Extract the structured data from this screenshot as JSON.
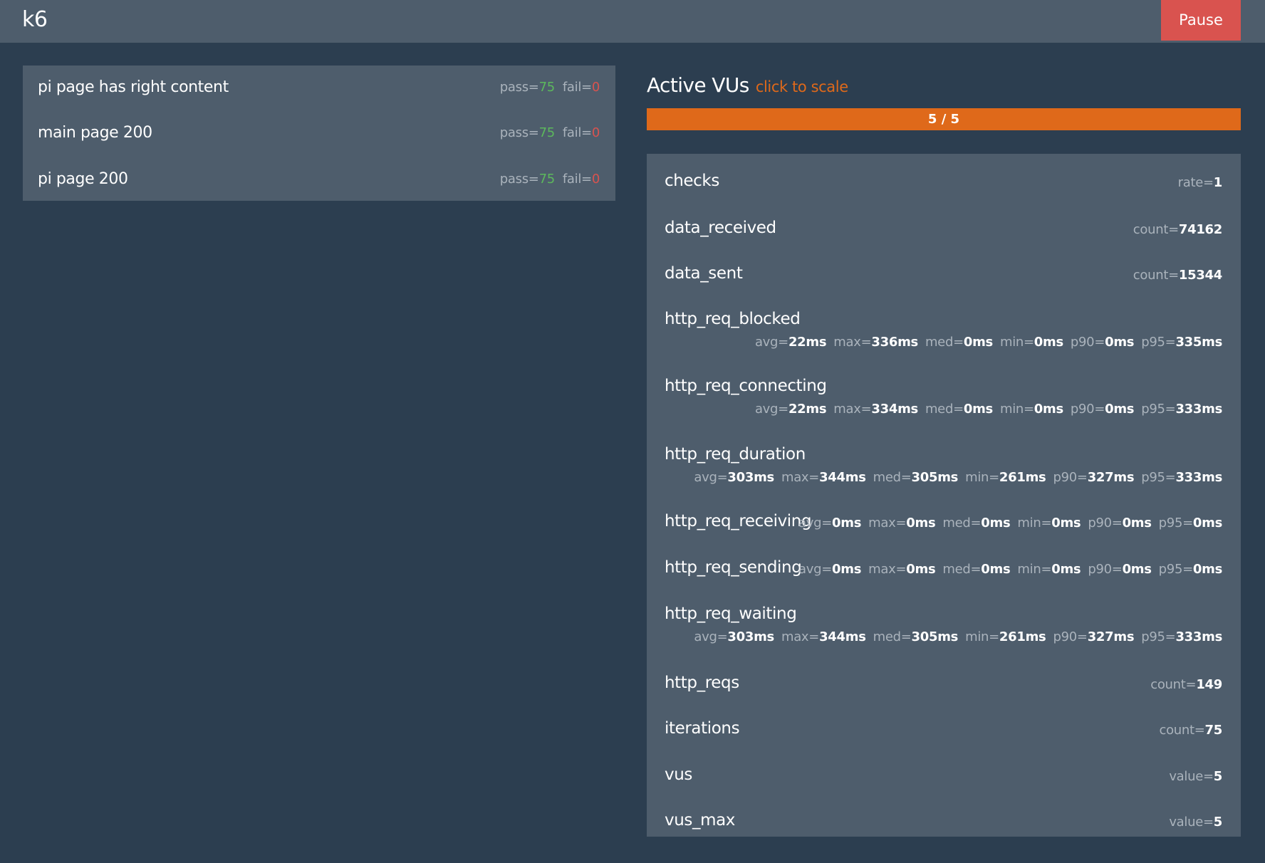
{
  "app": {
    "brand": "k6",
    "pause_label": "Pause"
  },
  "checks": [
    {
      "name": "pi page has right content",
      "pass_label": "pass=",
      "pass": "75",
      "fail_label": "fail=",
      "fail": "0"
    },
    {
      "name": "main page 200",
      "pass_label": "pass=",
      "pass": "75",
      "fail_label": "fail=",
      "fail": "0"
    },
    {
      "name": "pi page 200",
      "pass_label": "pass=",
      "pass": "75",
      "fail_label": "fail=",
      "fail": "0"
    }
  ],
  "vus": {
    "title": "Active VUs",
    "scale_link": "click to scale",
    "label": "5 / 5",
    "active": 5,
    "max": 5,
    "fill_fraction": 1.0
  },
  "metrics": [
    {
      "name": "checks",
      "stats": [
        {
          "k": "rate=",
          "v": "1"
        }
      ]
    },
    {
      "name": "data_received",
      "stats": [
        {
          "k": "count=",
          "v": "74162"
        }
      ]
    },
    {
      "name": "data_sent",
      "stats": [
        {
          "k": "count=",
          "v": "15344"
        }
      ]
    },
    {
      "name": "http_req_blocked",
      "stats": [
        {
          "k": "avg=",
          "v": "22ms"
        },
        {
          "k": "max=",
          "v": "336ms"
        },
        {
          "k": "med=",
          "v": "0ms"
        },
        {
          "k": "min=",
          "v": "0ms"
        },
        {
          "k": "p90=",
          "v": "0ms"
        },
        {
          "k": "p95=",
          "v": "335ms"
        }
      ]
    },
    {
      "name": "http_req_connecting",
      "stats": [
        {
          "k": "avg=",
          "v": "22ms"
        },
        {
          "k": "max=",
          "v": "334ms"
        },
        {
          "k": "med=",
          "v": "0ms"
        },
        {
          "k": "min=",
          "v": "0ms"
        },
        {
          "k": "p90=",
          "v": "0ms"
        },
        {
          "k": "p95=",
          "v": "333ms"
        }
      ]
    },
    {
      "name": "http_req_duration",
      "stats": [
        {
          "k": "avg=",
          "v": "303ms"
        },
        {
          "k": "max=",
          "v": "344ms"
        },
        {
          "k": "med=",
          "v": "305ms"
        },
        {
          "k": "min=",
          "v": "261ms"
        },
        {
          "k": "p90=",
          "v": "327ms"
        },
        {
          "k": "p95=",
          "v": "333ms"
        }
      ]
    },
    {
      "name": "http_req_receiving",
      "stats": [
        {
          "k": "avg=",
          "v": "0ms"
        },
        {
          "k": "max=",
          "v": "0ms"
        },
        {
          "k": "med=",
          "v": "0ms"
        },
        {
          "k": "min=",
          "v": "0ms"
        },
        {
          "k": "p90=",
          "v": "0ms"
        },
        {
          "k": "p95=",
          "v": "0ms"
        }
      ]
    },
    {
      "name": "http_req_sending",
      "stats": [
        {
          "k": "avg=",
          "v": "0ms"
        },
        {
          "k": "max=",
          "v": "0ms"
        },
        {
          "k": "med=",
          "v": "0ms"
        },
        {
          "k": "min=",
          "v": "0ms"
        },
        {
          "k": "p90=",
          "v": "0ms"
        },
        {
          "k": "p95=",
          "v": "0ms"
        }
      ]
    },
    {
      "name": "http_req_waiting",
      "stats": [
        {
          "k": "avg=",
          "v": "303ms"
        },
        {
          "k": "max=",
          "v": "344ms"
        },
        {
          "k": "med=",
          "v": "305ms"
        },
        {
          "k": "min=",
          "v": "261ms"
        },
        {
          "k": "p90=",
          "v": "327ms"
        },
        {
          "k": "p95=",
          "v": "333ms"
        }
      ]
    },
    {
      "name": "http_reqs",
      "stats": [
        {
          "k": "count=",
          "v": "149"
        }
      ]
    },
    {
      "name": "iterations",
      "stats": [
        {
          "k": "count=",
          "v": "75"
        }
      ]
    },
    {
      "name": "vus",
      "stats": [
        {
          "k": "value=",
          "v": "5"
        }
      ]
    },
    {
      "name": "vus_max",
      "stats": [
        {
          "k": "value=",
          "v": "5"
        }
      ]
    }
  ]
}
